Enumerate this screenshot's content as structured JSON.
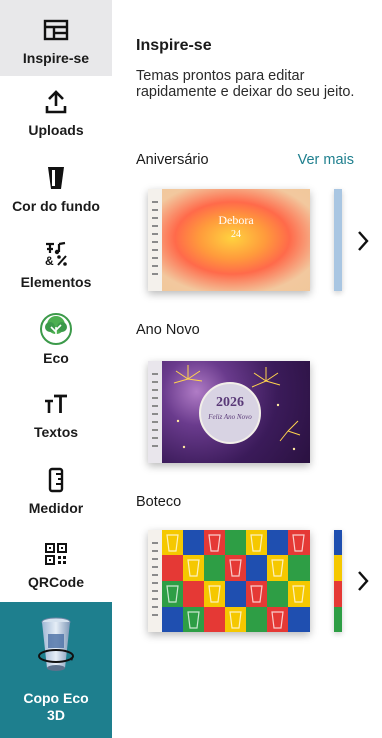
{
  "sidebar": {
    "items": [
      {
        "label": "Inspire-se",
        "icon": "layout-grid-icon"
      },
      {
        "label": "Uploads",
        "icon": "upload-icon"
      },
      {
        "label": "Cor do fundo",
        "icon": "cup-icon"
      },
      {
        "label": "Elementos",
        "icon": "elements-icon"
      },
      {
        "label": "Eco",
        "icon": "tree-icon"
      },
      {
        "label": "Textos",
        "icon": "text-icon"
      },
      {
        "label": "Medidor",
        "icon": "ruler-icon"
      },
      {
        "label": "QRCode",
        "icon": "qrcode-icon"
      },
      {
        "label": "Copo Eco 3D",
        "icon": "cup-3d-icon"
      }
    ]
  },
  "panel": {
    "title": "Inspire-se",
    "description": "Temas prontos para editar rapidamente e deixar do seu jeito.",
    "sections": [
      {
        "title": "Aniversário",
        "see_more": "Ver mais",
        "card_name": "Debora",
        "card_number": "24"
      },
      {
        "title": "Ano Novo",
        "card_year": "2026",
        "card_text": "Feliz Ano Novo"
      },
      {
        "title": "Boteco"
      }
    ]
  },
  "colors": {
    "accent": "#1e7f8e",
    "eco_green": "#3c9a4a"
  }
}
